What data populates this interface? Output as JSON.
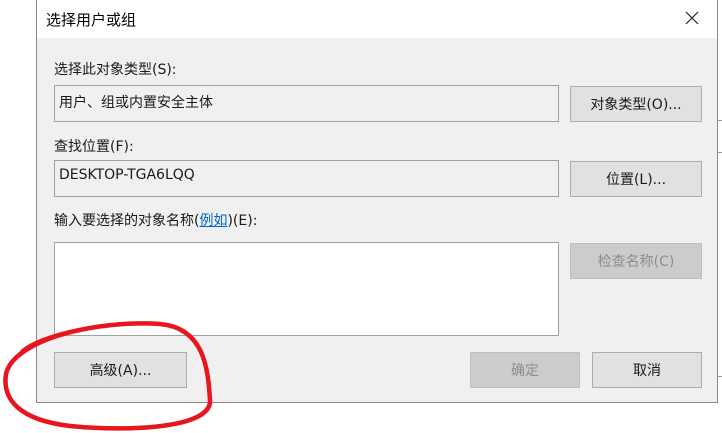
{
  "dialog": {
    "title": "选择用户或组",
    "close_icon": "close-icon"
  },
  "object_type": {
    "label": "选择此对象类型(S):",
    "value": "用户、组或内置安全主体",
    "button": "对象类型(O)..."
  },
  "location": {
    "label": "查找位置(F):",
    "value": "DESKTOP-TGA6LQQ",
    "button": "位置(L)..."
  },
  "names": {
    "label_prefix": "输入要选择的对象名称(",
    "label_link": "例如",
    "label_suffix": ")(E):",
    "value": "",
    "check_button": "检查名称(C)"
  },
  "footer": {
    "advanced_button": "高级(A)...",
    "ok_button": "确定",
    "cancel_button": "取消"
  },
  "colors": {
    "annotation": "#e8141e",
    "link": "#0066cc",
    "dialog_bg": "#f0f0f0"
  }
}
